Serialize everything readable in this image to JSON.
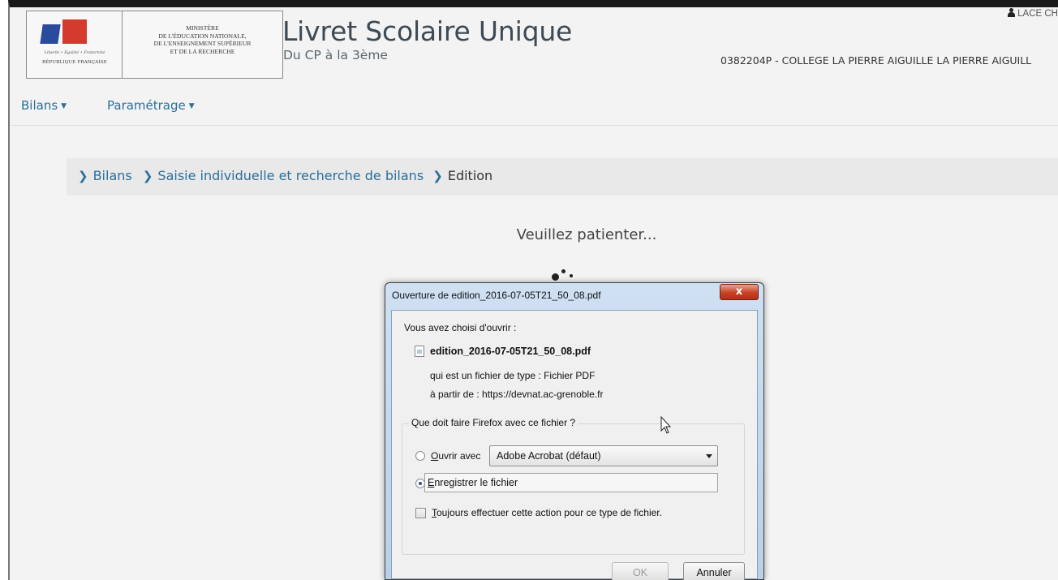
{
  "header": {
    "ministry_lines": [
      "MINISTÈRE",
      "DE L'ÉDUCATION NATIONALE,",
      "DE L'ENSEIGNEMENT SUPÉRIEUR",
      "ET DE LA RECHERCHE"
    ],
    "motto": "Liberté • Égalité • Fraternité",
    "republic": "RÉPUBLIQUE FRANÇAISE",
    "app_title": "Livret Scolaire Unique",
    "app_subtitle": "Du CP à la 3ème",
    "user": "LACE CH",
    "school": "0382204P - COLLEGE LA PIERRE AIGUILLE LA PIERRE AIGUILL"
  },
  "nav": {
    "items": [
      {
        "label": "Bilans"
      },
      {
        "label": "Paramétrage"
      }
    ]
  },
  "breadcrumb": {
    "items": [
      "Bilans",
      "Saisie individuelle et recherche de bilans",
      "Edition"
    ]
  },
  "status": {
    "waiting": "Veuillez patienter..."
  },
  "dialog": {
    "title": "Ouverture de edition_2016-07-05T21_50_08.pdf",
    "close": "x",
    "intro": "Vous avez choisi d'ouvrir :",
    "filename": "edition_2016-07-05T21_50_08.pdf",
    "file_type": "qui est un fichier de type : Fichier PDF",
    "source": "à partir de : https://devnat.ac-grenoble.fr",
    "question": "Que doit faire Firefox avec ce fichier ?",
    "open_with_label_u": "O",
    "open_with_label_rest": "uvrir avec",
    "open_with_app": "Adobe Acrobat  (défaut)",
    "save_label_u": "E",
    "save_label_rest": "nregistrer le fichier",
    "always_label_u": "T",
    "always_label_rest": "oujours effectuer cette action pour ce type de fichier.",
    "selected_option": "save",
    "always_checked": false,
    "ok": "OK",
    "cancel": "Annuler"
  },
  "colors": {
    "link": "#2a6f9b",
    "dialog_frame": "#b9d0ea",
    "close_button": "#c84124"
  }
}
